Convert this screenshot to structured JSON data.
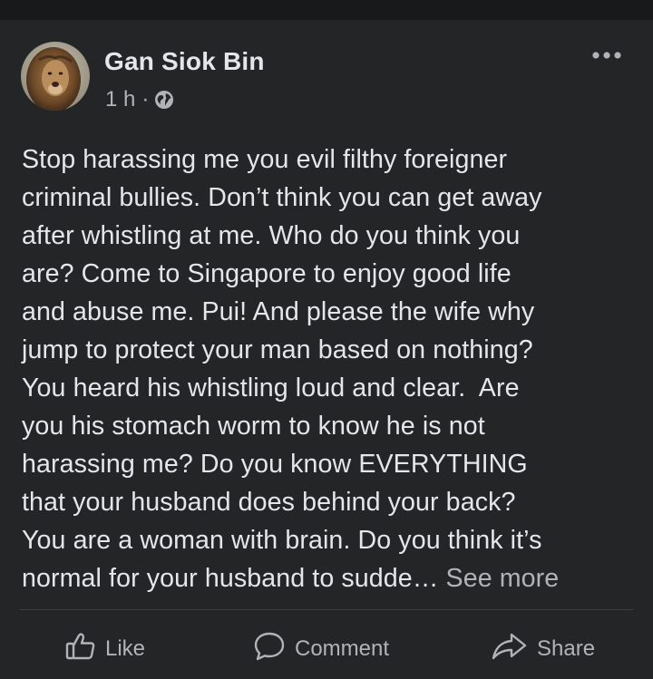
{
  "post": {
    "author": "Gan Siok Bin",
    "time": "1 h",
    "separator": "·",
    "audience_icon": "globe-icon",
    "more_icon": "more-options-icon",
    "body_lines": [
      "Stop harassing me you evil filthy foreigner",
      "criminal bullies. Don’t think you can get away",
      "after whistling at me. Who do you think you",
      "are? Come to Singapore to enjoy good life",
      "and abuse me. Pui! And please the wife why",
      "jump to protect your man based on nothing?",
      "You heard his whistling loud and clear.  Are",
      "you his stomach worm to know he is not",
      "harassing me? Do you know EVERYTHING",
      "that your husband does behind your back?",
      "You are a woman with brain. Do you think it’s"
    ],
    "last_line": "normal for your husband to sudde…",
    "see_more": "See more"
  },
  "actions": {
    "like": "Like",
    "comment": "Comment",
    "share": "Share"
  },
  "colors": {
    "background": "#18191a",
    "card": "#242526",
    "text": "#e4e6eb",
    "secondary": "#b0b3b8"
  }
}
